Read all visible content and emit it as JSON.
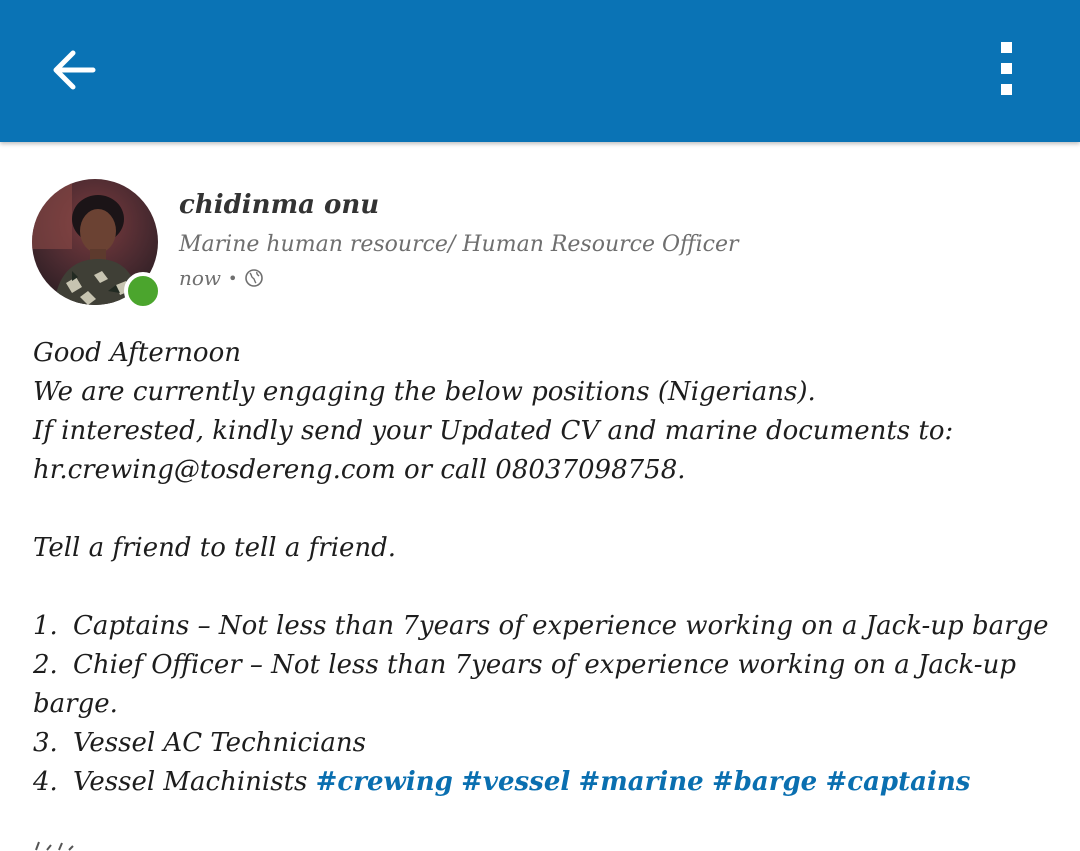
{
  "header": {
    "back_icon": "arrow-left-icon",
    "menu_icon": "more-vertical-icon",
    "background_color": "#0a73b5"
  },
  "author": {
    "name": "chidinma onu",
    "headline": "Marine human resource/ Human Resource Officer",
    "time": "now",
    "separator": "•",
    "visibility_icon": "globe-icon",
    "online_status_color": "#4ba52d"
  },
  "post": {
    "intro": [
      "Good Afternoon",
      "We are currently engaging the below positions (Nigerians).",
      "If interested, kindly send your Updated CV and marine documents to:",
      "hr.crewing@tosdereng.com or call  08037098758."
    ],
    "share_note": "Tell a friend to tell a friend.",
    "positions": [
      {
        "num": "1.",
        "text": "Captains – Not less than 7years of experience working on a Jack-up barge"
      },
      {
        "num": "2.",
        "text": "Chief Officer  – Not less than 7years of experience working on a Jack-up"
      },
      {
        "num": "",
        "text": "barge."
      },
      {
        "num": "3.",
        "text": "Vessel AC Technicians"
      },
      {
        "num": "4.",
        "text": "Vessel Machinists"
      }
    ],
    "hashtags": [
      "#crewing",
      "#vessel",
      "#marine",
      "#barge",
      "#captains"
    ],
    "hashtag_color": "#0a6fb0"
  }
}
